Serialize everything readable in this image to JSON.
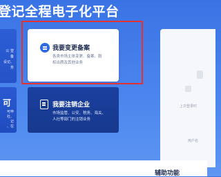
{
  "hero": {
    "title": "登记全程电子化平台"
  },
  "left_cards": {
    "top_snippets": [
      "公 登",
      "备",
      "设记、",
      "务"
    ],
    "bottom_big": "可",
    "bottom_snippets": [
      "可申",
      "社、",
      "记",
      "、在",
      "务"
    ]
  },
  "change_card": {
    "title": "我要变更备案",
    "desc": "各类市场主体变更、备案、股权出质及其他业务"
  },
  "cancel_card": {
    "title": "我要注销企业",
    "desc": "市场监管、公安、税务、海关、人社等部门的注销业务"
  },
  "right_panel": {
    "last_login": "上次登录时",
    "username_label": "用户名"
  },
  "aux": {
    "title": "辅助功能"
  },
  "colors": {
    "hero_bg": "#3a73e4",
    "highlight": "#e5312f",
    "cancel_card_bg": "#1a3f9e"
  }
}
